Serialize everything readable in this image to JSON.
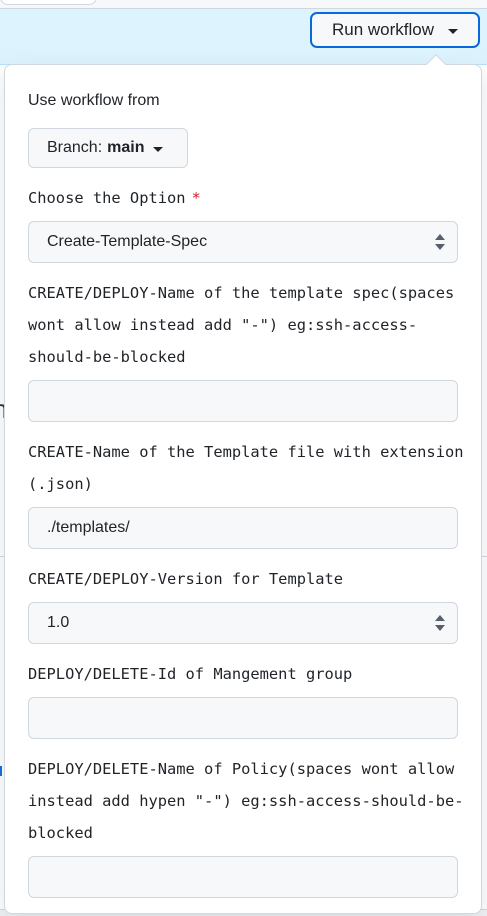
{
  "header": {
    "run_workflow_label": "Run workflow"
  },
  "background": {
    "partial_glyph": "n"
  },
  "form": {
    "use_workflow_label": "Use workflow from",
    "branch": {
      "prefix": "Branch:",
      "name": "main"
    },
    "option": {
      "label": "Choose the Option",
      "required_mark": "*",
      "value": "Create-Template-Spec"
    },
    "template_spec_name": {
      "label": "CREATE/DEPLOY-Name of the template spec(spaces wont allow instead add \"-\") eg:ssh-access-should-be-blocked",
      "value": ""
    },
    "template_file_name": {
      "label": "CREATE-Name of the Template file with extension (.json)",
      "value": "./templates/"
    },
    "template_version": {
      "label": "CREATE/DEPLOY-Version for Template",
      "value": "1.0"
    },
    "management_group_id": {
      "label": "DEPLOY/DELETE-Id of Mangement group",
      "value": ""
    },
    "policy_name": {
      "label": "DEPLOY/DELETE-Name of Policy(spaces wont allow instead add hypen \"-\") eg:ssh-access-should-be-blocked",
      "value": ""
    }
  },
  "colors": {
    "accent": "#0969da",
    "required": "#cf222e",
    "banner": "#ddf4ff",
    "field_bg": "#f6f8fa",
    "border": "#d0d7de"
  },
  "icons": {
    "run_caret": "chevron-down-icon",
    "branch_caret": "chevron-down-icon",
    "select_arrows": "select-updown-icon"
  }
}
